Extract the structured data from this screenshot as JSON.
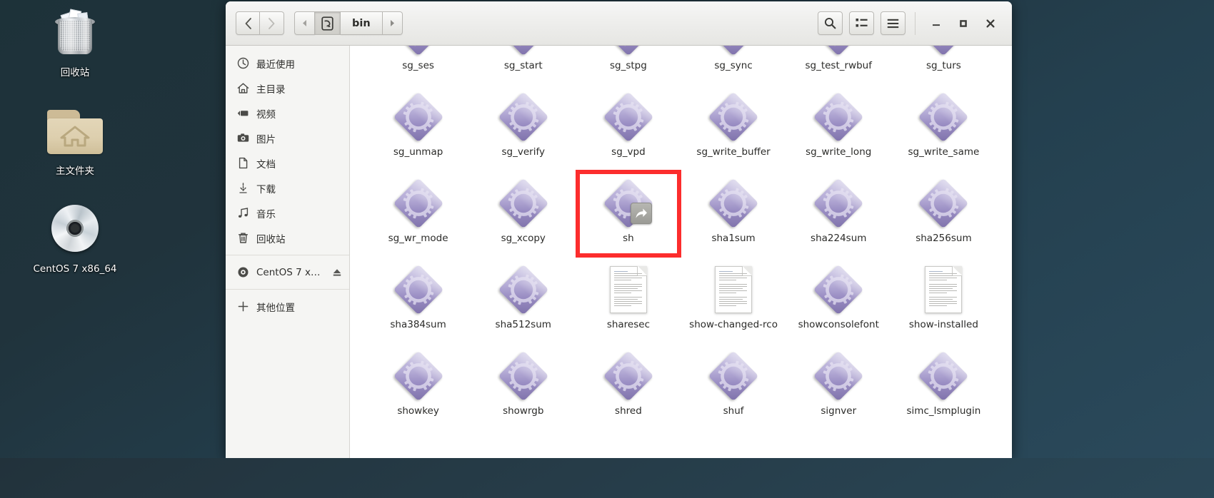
{
  "desktop": {
    "icons": [
      {
        "label": "回收站",
        "icon": "trash-icon"
      },
      {
        "label": "主文件夹",
        "icon": "home-folder-icon"
      },
      {
        "label": "CentOS 7 x86_64",
        "icon": "optical-disc-icon"
      }
    ]
  },
  "window": {
    "title": "bin",
    "nav": {
      "back_label": "‹",
      "forward_label": "›"
    },
    "pathbar": {
      "prev_label": "◂",
      "next_label": "▸",
      "root_icon": "filesystem-icon",
      "crumb_label": "bin"
    },
    "tools": {
      "search_label": "search-icon",
      "view_list_label": "list-view-icon",
      "menu_label": "hamburger-menu-icon"
    },
    "controls": {
      "minimize_label": "–",
      "maximize_label": "□",
      "close_label": "✕"
    }
  },
  "sidebar": {
    "items": [
      {
        "label": "最近使用",
        "icon": "clock-icon",
        "eject": false
      },
      {
        "label": "主目录",
        "icon": "home-icon",
        "eject": false
      },
      {
        "label": "视频",
        "icon": "video-icon",
        "eject": false
      },
      {
        "label": "图片",
        "icon": "camera-icon",
        "eject": false
      },
      {
        "label": "文档",
        "icon": "document-icon",
        "eject": false
      },
      {
        "label": "下载",
        "icon": "download-icon",
        "eject": false
      },
      {
        "label": "音乐",
        "icon": "music-icon",
        "eject": false
      },
      {
        "label": "回收站",
        "icon": "trash-icon",
        "eject": false
      }
    ],
    "devices": [
      {
        "label": "CentOS 7 x…",
        "icon": "optical-disc-icon",
        "eject": true
      }
    ],
    "other": [
      {
        "label": "其他位置",
        "icon": "plus-icon",
        "eject": false
      }
    ]
  },
  "files": {
    "selected": "sh",
    "items": [
      {
        "name": "sg_ses",
        "type": "executable",
        "link": false
      },
      {
        "name": "sg_start",
        "type": "executable",
        "link": false
      },
      {
        "name": "sg_stpg",
        "type": "executable",
        "link": false
      },
      {
        "name": "sg_sync",
        "type": "executable",
        "link": false
      },
      {
        "name": "sg_test_rwbuf",
        "type": "executable",
        "link": false
      },
      {
        "name": "sg_turs",
        "type": "executable",
        "link": false
      },
      {
        "name": "sg_unmap",
        "type": "executable",
        "link": false
      },
      {
        "name": "sg_verify",
        "type": "executable",
        "link": false
      },
      {
        "name": "sg_vpd",
        "type": "executable",
        "link": false
      },
      {
        "name": "sg_write_buffer",
        "type": "executable",
        "link": false
      },
      {
        "name": "sg_write_long",
        "type": "executable",
        "link": false
      },
      {
        "name": "sg_write_same",
        "type": "executable",
        "link": false
      },
      {
        "name": "sg_wr_mode",
        "type": "executable",
        "link": false
      },
      {
        "name": "sg_xcopy",
        "type": "executable",
        "link": false
      },
      {
        "name": "sh",
        "type": "executable",
        "link": true
      },
      {
        "name": "sha1sum",
        "type": "executable",
        "link": false
      },
      {
        "name": "sha224sum",
        "type": "executable",
        "link": false
      },
      {
        "name": "sha256sum",
        "type": "executable",
        "link": false
      },
      {
        "name": "sha384sum",
        "type": "executable",
        "link": false
      },
      {
        "name": "sha512sum",
        "type": "executable",
        "link": false
      },
      {
        "name": "sharesec",
        "type": "document",
        "link": false
      },
      {
        "name": "show-changed-rco",
        "type": "document",
        "link": false
      },
      {
        "name": "showconsolefont",
        "type": "executable",
        "link": false
      },
      {
        "name": "show-installed",
        "type": "document",
        "link": false
      },
      {
        "name": "showkey",
        "type": "executable",
        "link": false
      },
      {
        "name": "showrgb",
        "type": "executable",
        "link": false
      },
      {
        "name": "shred",
        "type": "executable",
        "link": false
      },
      {
        "name": "shuf",
        "type": "executable",
        "link": false
      },
      {
        "name": "signver",
        "type": "executable",
        "link": false
      },
      {
        "name": "simc_lsmplugin",
        "type": "executable",
        "link": false
      }
    ]
  },
  "colors": {
    "highlight": "#fc2d2d",
    "desktop_bg": "#24404f",
    "exec_icon": "#9b8fc4",
    "window_chrome": "#eeeeec"
  }
}
